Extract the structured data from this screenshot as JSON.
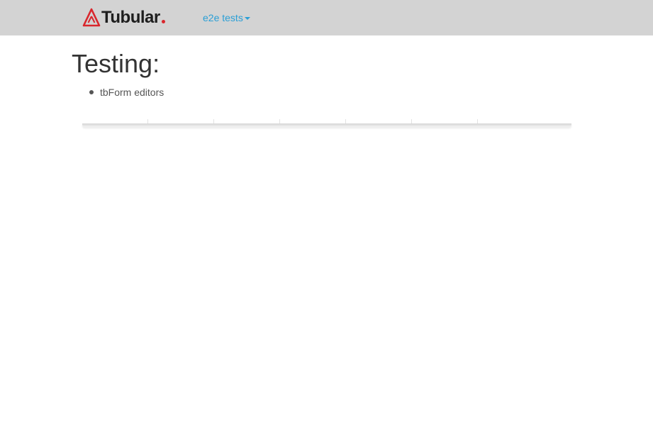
{
  "navbar": {
    "brand_text": "Tubular",
    "brand_color": "#d9262c",
    "brand_icon": "tubular-logo-icon",
    "dropdown_label": "e2e tests",
    "dropdown_color": "#2a9fd6",
    "dropdown_icon": "caret-down-icon",
    "background": "#d3d3d3"
  },
  "main": {
    "title": "Testing:",
    "tests": [
      {
        "label": "tbForm editors"
      }
    ]
  },
  "grid": {
    "columns": [
      "",
      "",
      "",
      "",
      "",
      "",
      ""
    ]
  }
}
